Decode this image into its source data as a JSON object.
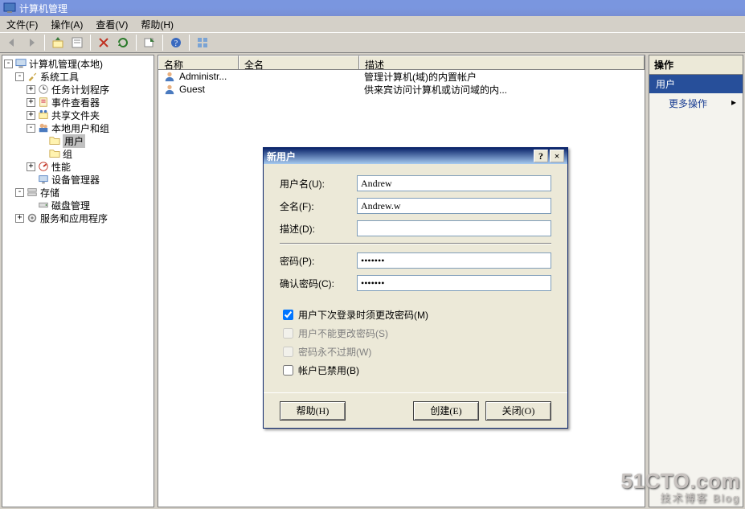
{
  "window": {
    "title": "计算机管理"
  },
  "menu": {
    "file": "文件(F)",
    "action": "操作(A)",
    "view": "查看(V)",
    "help": "帮助(H)"
  },
  "tree": {
    "root": "计算机管理(本地)",
    "systools": "系统工具",
    "tasksched": "任务计划程序",
    "eventwr": "事件查看器",
    "shared": "共享文件夹",
    "localusers": "本地用户和组",
    "users": "用户",
    "groups": "组",
    "perf": "性能",
    "devmgr": "设备管理器",
    "storage": "存储",
    "diskmgmt": "磁盘管理",
    "services": "服务和应用程序"
  },
  "list": {
    "cols": {
      "name": "名称",
      "fullname": "全名",
      "desc": "描述"
    },
    "rows": [
      {
        "name": "Administr...",
        "full": "",
        "desc": "管理计算机(域)的内置帐户"
      },
      {
        "name": "Guest",
        "full": "",
        "desc": "供来宾访问计算机或访问域的内..."
      }
    ]
  },
  "actions": {
    "title": "操作",
    "category": "用户",
    "more": "更多操作"
  },
  "dialog": {
    "title": "新用户",
    "username_lbl": "用户名(U):",
    "username_val": "Andrew",
    "fullname_lbl": "全名(F):",
    "fullname_val": "Andrew.w",
    "desc_lbl": "描述(D):",
    "desc_val": "",
    "pwd_lbl": "密码(P):",
    "pwd_val": "•••••••",
    "cpwd_lbl": "确认密码(C):",
    "cpwd_val": "•••••••",
    "chk_mustchange": "用户下次登录时须更改密码(M)",
    "chk_cannotchange": "用户不能更改密码(S)",
    "chk_neverexpire": "密码永不过期(W)",
    "chk_disabled": "帐户已禁用(B)",
    "btn_help": "帮助(H)",
    "btn_create": "创建(E)",
    "btn_close": "关闭(O)"
  },
  "watermark": {
    "big": "51CTO.com",
    "small": "技术博客   Blog"
  }
}
